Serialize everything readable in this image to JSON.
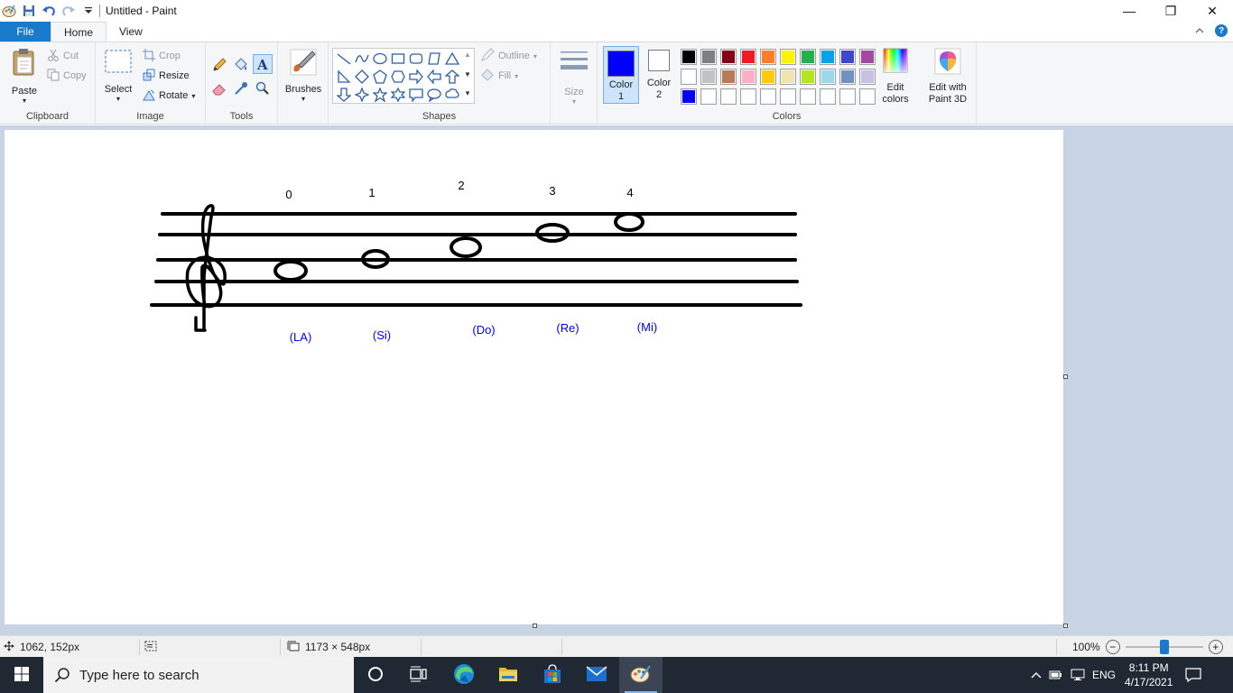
{
  "window": {
    "title": "Untitled - Paint",
    "minimize_glyph": "—",
    "maximize_glyph": "❐",
    "close_glyph": "✕"
  },
  "ribbon_tabs": {
    "file": "File",
    "home": "Home",
    "view": "View"
  },
  "clipboard": {
    "paste": "Paste",
    "cut": "Cut",
    "copy": "Copy",
    "label": "Clipboard"
  },
  "image": {
    "select": "Select",
    "crop": "Crop",
    "resize": "Resize",
    "rotate": "Rotate",
    "label": "Image"
  },
  "tools": {
    "label": "Tools"
  },
  "brushes": {
    "label": "Brushes"
  },
  "shapes": {
    "outline": "Outline",
    "fill": "Fill",
    "label": "Shapes"
  },
  "size": {
    "label": "Size"
  },
  "colors": {
    "color1_line1": "Color",
    "color1_line2": "1",
    "color2_line1": "Color",
    "color2_line2": "2",
    "color1_value": "#0000ff",
    "color2_value": "#ffffff",
    "edit_colors_line1": "Edit",
    "edit_colors_line2": "colors",
    "label": "Colors",
    "palette_row1": [
      "#000000",
      "#7f7f7f",
      "#880015",
      "#ed1c24",
      "#ff7f27",
      "#fff200",
      "#22b14c",
      "#00a2e8",
      "#3f48cc",
      "#a349a4"
    ],
    "palette_row2": [
      "#ffffff",
      "#c3c3c3",
      "#b97a57",
      "#ffaec9",
      "#ffc90e",
      "#efe4b0",
      "#b5e61d",
      "#99d9ea",
      "#7092be",
      "#c8bfe7"
    ],
    "palette_row3": [
      "#0000ff",
      "#ffffff",
      "#ffffff",
      "#ffffff",
      "#ffffff",
      "#ffffff",
      "#ffffff",
      "#ffffff",
      "#ffffff",
      "#ffffff"
    ]
  },
  "paint3d": {
    "line1": "Edit with",
    "line2": "Paint 3D"
  },
  "drawing": {
    "numbers": [
      "0",
      "1",
      "2",
      "3",
      "4"
    ],
    "note_names": [
      "(LA)",
      "(Si)",
      "(Do)",
      "(Re)",
      "(Mi)"
    ],
    "note_name_color": "#0000ff"
  },
  "status": {
    "cursor_position": "1062, 152px",
    "selection_size": "",
    "image_size": "1173 × 548px",
    "zoom": "100%",
    "zoom_level_percent": 100
  },
  "taskbar": {
    "search_placeholder": "Type here to search",
    "language": "ENG",
    "time": "8:11 PM",
    "date": "4/17/2021"
  }
}
